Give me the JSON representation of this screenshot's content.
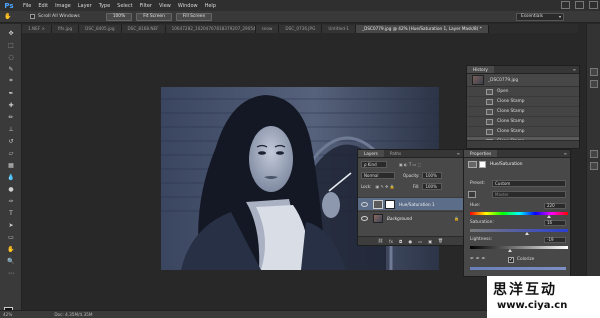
{
  "menubar": {
    "logo": "Ps",
    "items": [
      "File",
      "Edit",
      "Image",
      "Layer",
      "Type",
      "Select",
      "Filter",
      "View",
      "Window",
      "Help"
    ]
  },
  "optionsbar": {
    "scroll_all_windows": "Scroll All Windows",
    "zoom_100": "100%",
    "fit_screen": "Fit Screen",
    "fill_screen": "Fill Screen",
    "workspace": "Essentials"
  },
  "tabs": [
    {
      "label": "1.NEF ×",
      "active": false
    },
    {
      "label": "fifs.jpg",
      "active": false
    },
    {
      "label": "DSC_8405.jpg",
      "active": false
    },
    {
      "label": "DSC_8168.NEF",
      "active": false
    },
    {
      "label": "10647282_10204767818379207_2905460115386937736_n.jpg",
      "active": false
    },
    {
      "label": "snow",
      "active": false
    },
    {
      "label": "DSC_0736.JPG",
      "active": false
    },
    {
      "label": "Untitled-1",
      "active": false
    },
    {
      "label": "_DSC0779.jpg @ 42% (Hue/Saturation 1, Layer Mask/8) *",
      "active": true
    }
  ],
  "status": {
    "zoom": "42%",
    "doc": "Doc: 4.35M/4.35M"
  },
  "history": {
    "tab": "History",
    "snapshot": "_DSC0779.jpg",
    "items": [
      "Open",
      "Clone Stamp",
      "Clone Stamp",
      "Clone Stamp",
      "Clone Stamp",
      "Clone Stamp"
    ]
  },
  "layers": {
    "tabs": [
      "Layers",
      "Paths"
    ],
    "kind": "ρ Kind",
    "blend_mode": "Normal",
    "opacity_label": "Opacity:",
    "opacity_value": "100%",
    "lock_label": "Lock:",
    "fill_label": "Fill:",
    "fill_value": "100%",
    "rows": [
      {
        "name": "Hue/Saturation 1",
        "active": true
      },
      {
        "name": "Background",
        "active": false
      }
    ],
    "footer": [
      "fx",
      "◘",
      "●",
      "▭",
      "▣",
      "🗑"
    ]
  },
  "properties": {
    "tab": "Properties",
    "title": "Hue/Saturation",
    "preset_label": "Preset:",
    "preset_value": "Custom",
    "channel_value": "Master",
    "hue_label": "Hue:",
    "hue_value": "220",
    "saturation_label": "Saturation:",
    "saturation_value": "16",
    "lightness_label": "Lightness:",
    "lightness_value": "-19",
    "colorize_label": "Colorize",
    "colorize_checked": true,
    "hue_level": 0.81,
    "saturation_level": 0.58,
    "lightness_level": 0.41
  },
  "watermark": {
    "title": "思洋互动",
    "url": "www.ciya.cn"
  }
}
